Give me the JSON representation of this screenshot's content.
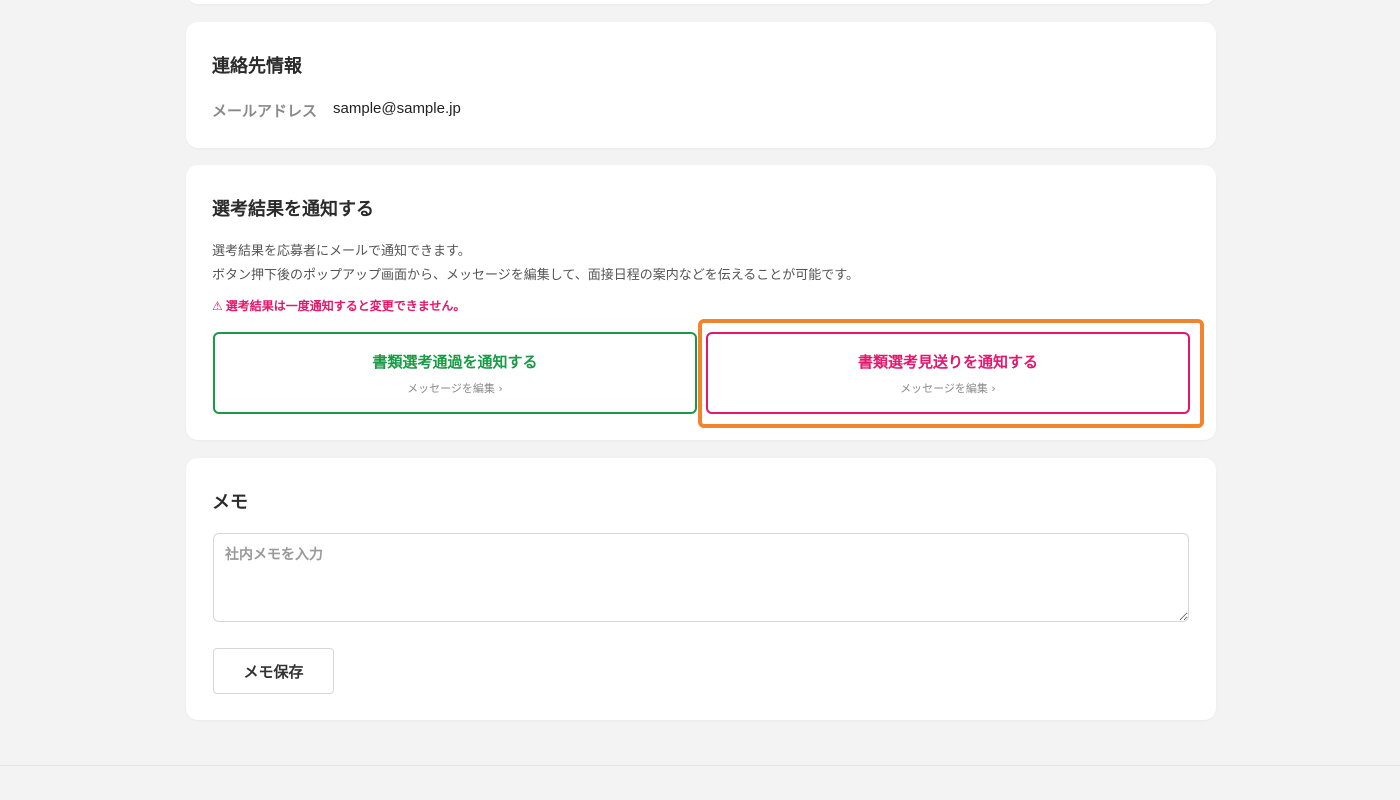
{
  "contact": {
    "title": "連絡先情報",
    "email_label": "メールアドレス",
    "email_value": "sample@sample.jp"
  },
  "result": {
    "title": "選考結果を通知する",
    "desc_line1": "選考結果を応募者にメールで通知できます。",
    "desc_line2": "ボタン押下後のポップアップ画面から、メッセージを編集して、面接日程の案内などを伝えることが可能です。",
    "warning_icon": "⚠",
    "warning": "選考結果は一度通知すると変更できません。",
    "pass_button": {
      "label": "書類選考通過を通知する",
      "sub": "メッセージを編集 ›"
    },
    "reject_button": {
      "label": "書類選考見送りを通知する",
      "sub": "メッセージを編集 ›"
    }
  },
  "memo": {
    "title": "メモ",
    "placeholder": "社内メモを入力",
    "save_label": "メモ保存"
  },
  "colors": {
    "pass": "#199a47",
    "reject": "#e4176c",
    "highlight": "#f4842c"
  }
}
